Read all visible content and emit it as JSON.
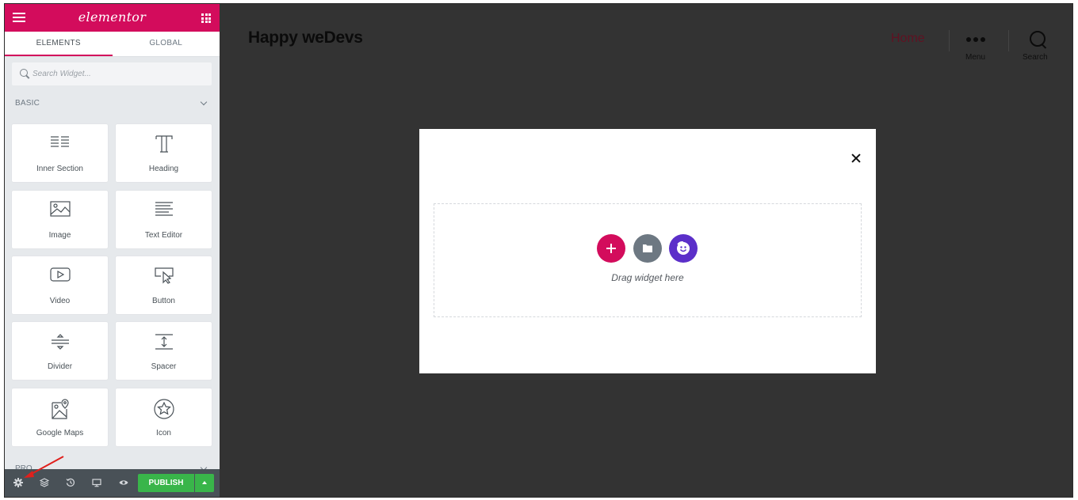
{
  "sidebar": {
    "logo": "elementor",
    "tabs": [
      {
        "label": "ELEMENTS",
        "active": true
      },
      {
        "label": "GLOBAL",
        "active": false
      }
    ],
    "search_placeholder": "Search Widget...",
    "category_basic": "BASIC",
    "category_pro": "PRO",
    "widgets": [
      {
        "label": "Inner Section",
        "icon": "inner-section-icon"
      },
      {
        "label": "Heading",
        "icon": "heading-icon"
      },
      {
        "label": "Image",
        "icon": "image-icon"
      },
      {
        "label": "Text Editor",
        "icon": "text-editor-icon"
      },
      {
        "label": "Video",
        "icon": "video-icon"
      },
      {
        "label": "Button",
        "icon": "button-icon"
      },
      {
        "label": "Divider",
        "icon": "divider-icon"
      },
      {
        "label": "Spacer",
        "icon": "spacer-icon"
      },
      {
        "label": "Google Maps",
        "icon": "google-maps-icon"
      },
      {
        "label": "Icon",
        "icon": "icon-widget-icon"
      }
    ],
    "bottom_icons": [
      "settings-icon",
      "navigator-layers-icon",
      "history-icon",
      "responsive-mode-icon",
      "preview-eye-icon"
    ],
    "publish_label": "PUBLISH"
  },
  "preview": {
    "site_title": "Happy weDevs",
    "nav_home": "Home",
    "menu_label": "Menu",
    "search_label": "Search"
  },
  "popup": {
    "drag_text": "Drag widget here"
  },
  "colors": {
    "brand": "#d30c5c",
    "publish_green": "#39b54a",
    "preview_bg": "#333333",
    "folder_grey": "#6d7882",
    "happy_purple": "#5b2fc9"
  }
}
